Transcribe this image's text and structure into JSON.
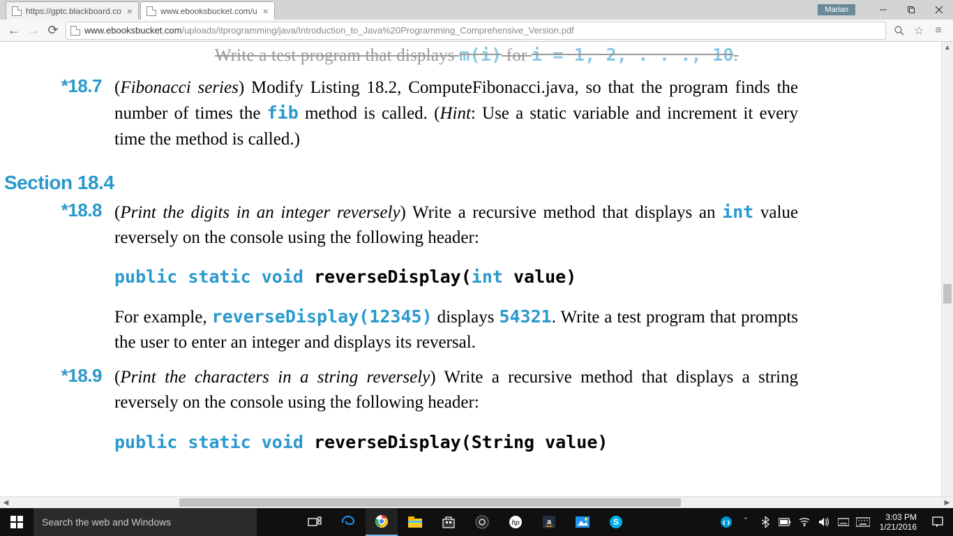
{
  "tabs": [
    {
      "title": "https://gptc.blackboard.co"
    },
    {
      "title": "www.ebooksbucket.com/u"
    }
  ],
  "user_badge": "Marian",
  "url": {
    "host": "www.ebooksbucket.com",
    "path": "/uploads/itprogramming/java/Introduction_to_Java%20Programming_Comprehensive_Version.pdf"
  },
  "content": {
    "partial_prefix": "Write a test program that displays ",
    "partial_code": "m(i)",
    "partial_mid": " for ",
    "partial_seq": "i = 1, 2, . . ., 10",
    "partial_end": ".",
    "ex187_num": "*18.7",
    "ex187_title": "Fibonacci series",
    "ex187_a": ") Modify Listing 18.2, ComputeFibonacci.java, so that the program finds the number of times the ",
    "ex187_code": "fib",
    "ex187_b": " method is called. (",
    "ex187_hint": "Hint",
    "ex187_c": ": Use a static variable and increment it every time the method is called.)",
    "section": "Section 18.4",
    "ex188_num": "*18.8",
    "ex188_title": "Print the digits in an integer reversely",
    "ex188_a": ") Write a recursive method that displays an ",
    "ex188_code1": "int",
    "ex188_b": " value reversely on the console using the following header:",
    "ex188_sig_kw": "public static void",
    "ex188_sig_name": " reverseDisplay(",
    "ex188_sig_kw2": "int",
    "ex188_sig_tail": " value)",
    "ex188_c": "For example, ",
    "ex188_code2": "reverseDisplay(12345)",
    "ex188_d": " displays ",
    "ex188_code3": "54321",
    "ex188_e": ". Write a test program that prompts the user to enter an integer and displays its reversal.",
    "ex189_num": "*18.9",
    "ex189_title": "Print the characters in a string reversely",
    "ex189_a": ") Write a recursive method that displays a string reversely on the console using the following header:",
    "ex189_sig_kw": "public static void",
    "ex189_sig_tail": " reverseDisplay(String value)"
  },
  "taskbar": {
    "search_placeholder": "Search the web and Windows",
    "time": "3:03 PM",
    "date": "1/21/2016"
  }
}
